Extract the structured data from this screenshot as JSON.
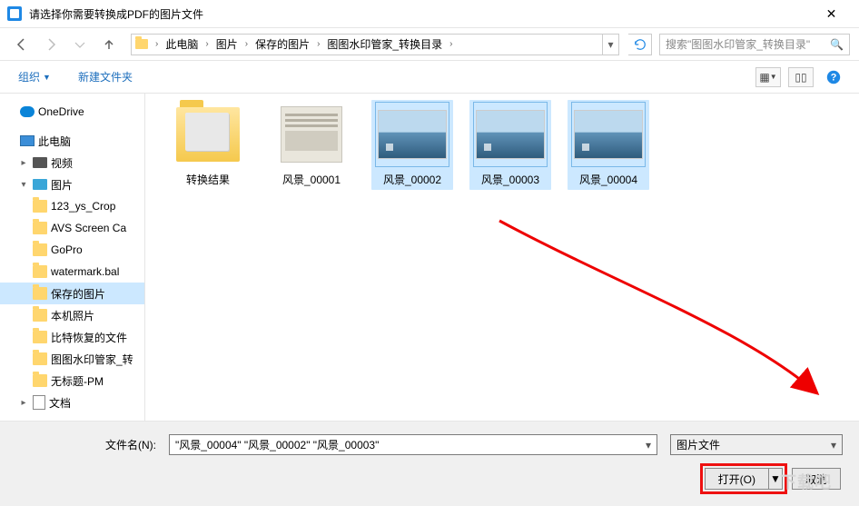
{
  "window": {
    "title": "请选择你需要转换成PDF的图片文件"
  },
  "breadcrumb": {
    "items": [
      "此电脑",
      "图片",
      "保存的图片",
      "图图水印管家_转换目录"
    ]
  },
  "search": {
    "placeholder": "搜索\"图图水印管家_转换目录\""
  },
  "toolbar": {
    "organize": "组织",
    "new_folder": "新建文件夹"
  },
  "sidebar": {
    "onedrive": "OneDrive",
    "pc": "此电脑",
    "video": "视频",
    "pictures": "图片",
    "folders": [
      "123_ys_Crop",
      "AVS Screen Ca",
      "GoPro",
      "watermark.bal",
      "保存的图片",
      "本机照片",
      "比特恢复的文件",
      "图图水印管家_转",
      "无标题-PM"
    ],
    "selected_index": 4,
    "documents": "文档"
  },
  "items": [
    {
      "label": "转换结果",
      "type": "folder",
      "selected": false
    },
    {
      "label": "风景_00001",
      "type": "memo",
      "selected": false
    },
    {
      "label": "风景_00002",
      "type": "photo",
      "selected": true
    },
    {
      "label": "风景_00003",
      "type": "photo",
      "selected": true
    },
    {
      "label": "风景_00004",
      "type": "photo",
      "selected": true
    }
  ],
  "footer": {
    "filename_label": "文件名(N):",
    "filename_value": "\"风景_00004\" \"风景_00002\" \"风景_00003\"",
    "filetype": "图片文件",
    "open": "打开(O)",
    "cancel": "取消"
  },
  "watermark": "下载吧"
}
